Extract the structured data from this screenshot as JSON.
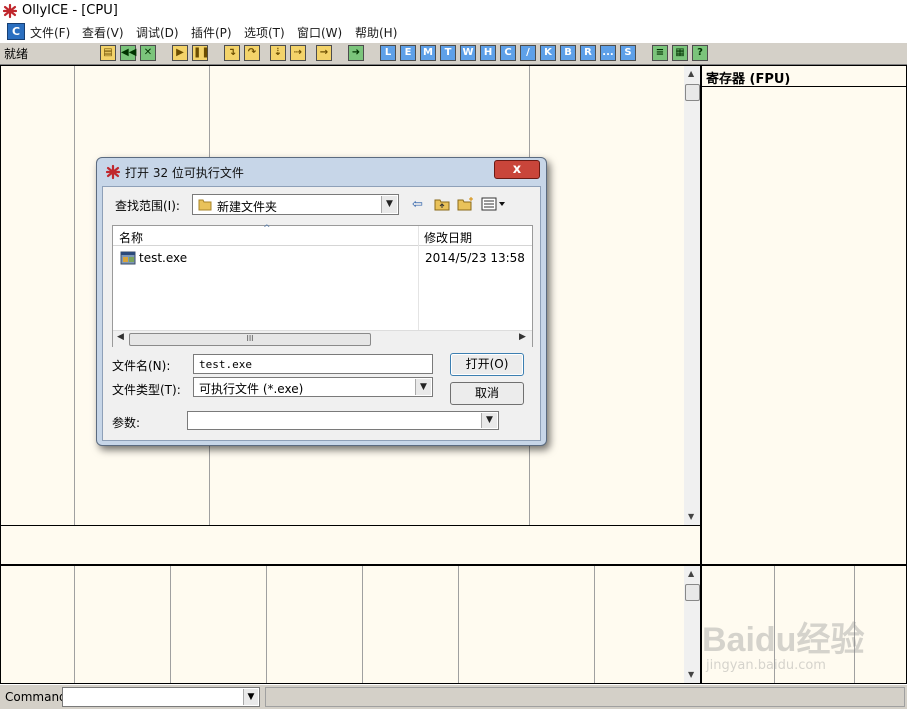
{
  "window": {
    "title": "OllyICE - [CPU]"
  },
  "menu": {
    "c_button": "C",
    "items": [
      "文件(F)",
      "查看(V)",
      "调试(D)",
      "插件(P)",
      "选项(T)",
      "窗口(W)",
      "帮助(H)"
    ]
  },
  "toolbar": {
    "status": "就绪",
    "letters": [
      "L",
      "E",
      "M",
      "T",
      "W",
      "H",
      "C",
      "/",
      "K",
      "B",
      "R",
      "...",
      "S"
    ]
  },
  "registers": {
    "title": "寄存器 (FPU)"
  },
  "dialog": {
    "title": "打开 32 位可执行文件",
    "close_glyph": "x",
    "look_in_label": "查找范围(I):",
    "look_in_value": "新建文件夹",
    "columns": [
      "名称",
      "修改日期"
    ],
    "files": [
      {
        "name": "test.exe",
        "modified": "2014/5/23 13:58"
      }
    ],
    "filename_label": "文件名(N):",
    "filename_value": "test.exe",
    "filetype_label": "文件类型(T):",
    "filetype_value": "可执行文件 (*.exe)",
    "params_label": "参数:",
    "params_value": "",
    "open_button": "打开(O)",
    "cancel_button": "取消",
    "scroll_grip": "III"
  },
  "command": {
    "label": "Command",
    "value": ""
  },
  "watermark": {
    "brand": "Baidu经验",
    "url": "jingyan.baidu.com"
  }
}
